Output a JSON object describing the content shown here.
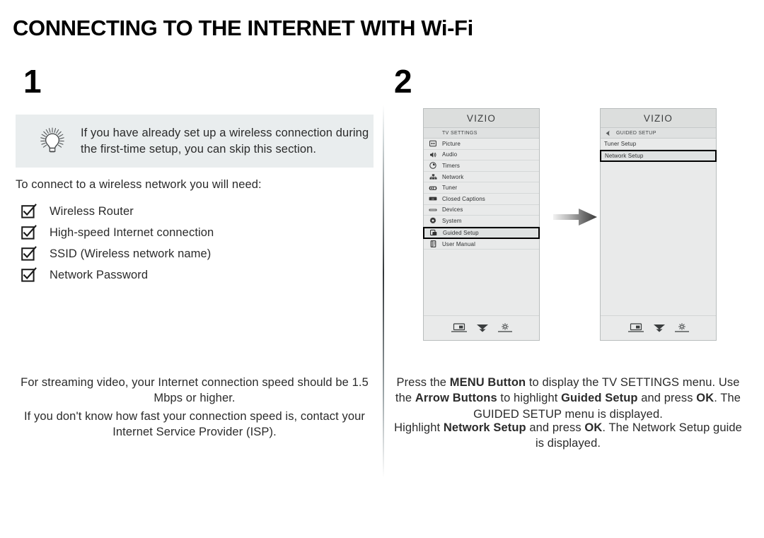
{
  "page": {
    "title": "CONNECTING TO THE INTERNET WITH Wi-Fi"
  },
  "steps": [
    {
      "number": "1"
    },
    {
      "number": "2"
    }
  ],
  "left_column": {
    "tip": {
      "icon": "lightbulb-icon",
      "text": "If you have already set up a wireless connection during the first-time setup, you can skip this section."
    },
    "intro": "To connect to a wireless network you will need:",
    "checklist": [
      {
        "label": "Wireless Router"
      },
      {
        "label": "High-speed Internet connection"
      },
      {
        "label": "SSID (Wireless network name)"
      },
      {
        "label": "Network Password"
      }
    ],
    "notes": [
      "For streaming video, your Internet connection speed should be 1.5 Mbps or higher.",
      "If you don't know how fast your connection speed is, contact your Internet Service Provider (ISP)."
    ]
  },
  "right_column": {
    "screens": [
      {
        "brand": "VIZIO",
        "section_header": "TV SETTINGS",
        "has_back_arrow": false,
        "items": [
          {
            "label": "Picture",
            "icon": "picture-icon",
            "selected": false
          },
          {
            "label": "Audio",
            "icon": "audio-icon",
            "selected": false
          },
          {
            "label": "Timers",
            "icon": "clock-icon",
            "selected": false
          },
          {
            "label": "Network",
            "icon": "network-icon",
            "selected": false
          },
          {
            "label": "Tuner",
            "icon": "tuner-icon",
            "selected": false
          },
          {
            "label": "Closed Captions",
            "icon": "closed-caption-icon",
            "selected": false
          },
          {
            "label": "Devices",
            "icon": "devices-icon",
            "selected": false
          },
          {
            "label": "System",
            "icon": "gear-icon",
            "selected": false
          },
          {
            "label": "Guided Setup",
            "icon": "guided-setup-icon",
            "selected": true
          },
          {
            "label": "User Manual",
            "icon": "manual-icon",
            "selected": false
          }
        ],
        "footer_icons": [
          "picture-in-picture-icon",
          "double-chevron-down-icon",
          "brightness-icon"
        ]
      },
      {
        "brand": "VIZIO",
        "section_header": "GUIDED SETUP",
        "has_back_arrow": true,
        "items": [
          {
            "label": "Tuner Setup",
            "icon": "",
            "selected": false
          },
          {
            "label": "Network Setup",
            "icon": "",
            "selected": true
          }
        ],
        "footer_icons": [
          "picture-in-picture-icon",
          "double-chevron-down-icon",
          "brightness-icon"
        ]
      }
    ],
    "transition_arrow": "right-arrow-icon",
    "instructions": [
      {
        "parts": [
          {
            "text": "Press the ",
            "bold": false
          },
          {
            "text": "MENU Button",
            "bold": true
          },
          {
            "text": " to display the TV SETTINGS menu. Use the ",
            "bold": false
          },
          {
            "text": "Arrow Buttons",
            "bold": true
          },
          {
            "text": " to highlight ",
            "bold": false
          },
          {
            "text": "Guided Setup",
            "bold": true
          },
          {
            "text": " and press ",
            "bold": false
          },
          {
            "text": "OK",
            "bold": true
          },
          {
            "text": ". The GUIDED SETUP menu is displayed.",
            "bold": false
          }
        ]
      },
      {
        "parts": [
          {
            "text": "Highlight ",
            "bold": false
          },
          {
            "text": "Network Setup",
            "bold": true
          },
          {
            "text": " and press ",
            "bold": false
          },
          {
            "text": "OK",
            "bold": true
          },
          {
            "text": ". The Network Setup guide is displayed.",
            "bold": false
          }
        ]
      }
    ]
  },
  "colors": {
    "tip_background": "#e9edee",
    "tv_background": "#e9eaea",
    "tv_brand_band": "#dcdedd",
    "selection_border": "#000000",
    "text": "#2b2b2b"
  }
}
